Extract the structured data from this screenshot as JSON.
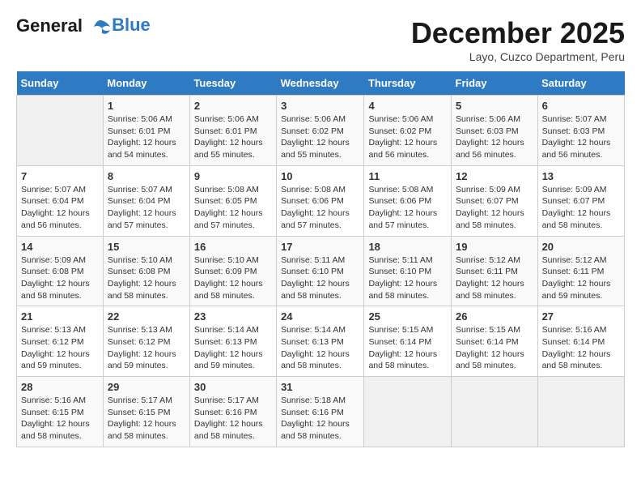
{
  "logo": {
    "line1": "General",
    "line2": "Blue"
  },
  "title": "December 2025",
  "location": "Layo, Cuzco Department, Peru",
  "days_of_week": [
    "Sunday",
    "Monday",
    "Tuesday",
    "Wednesday",
    "Thursday",
    "Friday",
    "Saturday"
  ],
  "weeks": [
    [
      {
        "num": "",
        "sunrise": "",
        "sunset": "",
        "daylight": ""
      },
      {
        "num": "1",
        "sunrise": "Sunrise: 5:06 AM",
        "sunset": "Sunset: 6:01 PM",
        "daylight": "Daylight: 12 hours and 54 minutes."
      },
      {
        "num": "2",
        "sunrise": "Sunrise: 5:06 AM",
        "sunset": "Sunset: 6:01 PM",
        "daylight": "Daylight: 12 hours and 55 minutes."
      },
      {
        "num": "3",
        "sunrise": "Sunrise: 5:06 AM",
        "sunset": "Sunset: 6:02 PM",
        "daylight": "Daylight: 12 hours and 55 minutes."
      },
      {
        "num": "4",
        "sunrise": "Sunrise: 5:06 AM",
        "sunset": "Sunset: 6:02 PM",
        "daylight": "Daylight: 12 hours and 56 minutes."
      },
      {
        "num": "5",
        "sunrise": "Sunrise: 5:06 AM",
        "sunset": "Sunset: 6:03 PM",
        "daylight": "Daylight: 12 hours and 56 minutes."
      },
      {
        "num": "6",
        "sunrise": "Sunrise: 5:07 AM",
        "sunset": "Sunset: 6:03 PM",
        "daylight": "Daylight: 12 hours and 56 minutes."
      }
    ],
    [
      {
        "num": "7",
        "sunrise": "Sunrise: 5:07 AM",
        "sunset": "Sunset: 6:04 PM",
        "daylight": "Daylight: 12 hours and 56 minutes."
      },
      {
        "num": "8",
        "sunrise": "Sunrise: 5:07 AM",
        "sunset": "Sunset: 6:04 PM",
        "daylight": "Daylight: 12 hours and 57 minutes."
      },
      {
        "num": "9",
        "sunrise": "Sunrise: 5:08 AM",
        "sunset": "Sunset: 6:05 PM",
        "daylight": "Daylight: 12 hours and 57 minutes."
      },
      {
        "num": "10",
        "sunrise": "Sunrise: 5:08 AM",
        "sunset": "Sunset: 6:06 PM",
        "daylight": "Daylight: 12 hours and 57 minutes."
      },
      {
        "num": "11",
        "sunrise": "Sunrise: 5:08 AM",
        "sunset": "Sunset: 6:06 PM",
        "daylight": "Daylight: 12 hours and 57 minutes."
      },
      {
        "num": "12",
        "sunrise": "Sunrise: 5:09 AM",
        "sunset": "Sunset: 6:07 PM",
        "daylight": "Daylight: 12 hours and 58 minutes."
      },
      {
        "num": "13",
        "sunrise": "Sunrise: 5:09 AM",
        "sunset": "Sunset: 6:07 PM",
        "daylight": "Daylight: 12 hours and 58 minutes."
      }
    ],
    [
      {
        "num": "14",
        "sunrise": "Sunrise: 5:09 AM",
        "sunset": "Sunset: 6:08 PM",
        "daylight": "Daylight: 12 hours and 58 minutes."
      },
      {
        "num": "15",
        "sunrise": "Sunrise: 5:10 AM",
        "sunset": "Sunset: 6:08 PM",
        "daylight": "Daylight: 12 hours and 58 minutes."
      },
      {
        "num": "16",
        "sunrise": "Sunrise: 5:10 AM",
        "sunset": "Sunset: 6:09 PM",
        "daylight": "Daylight: 12 hours and 58 minutes."
      },
      {
        "num": "17",
        "sunrise": "Sunrise: 5:11 AM",
        "sunset": "Sunset: 6:10 PM",
        "daylight": "Daylight: 12 hours and 58 minutes."
      },
      {
        "num": "18",
        "sunrise": "Sunrise: 5:11 AM",
        "sunset": "Sunset: 6:10 PM",
        "daylight": "Daylight: 12 hours and 58 minutes."
      },
      {
        "num": "19",
        "sunrise": "Sunrise: 5:12 AM",
        "sunset": "Sunset: 6:11 PM",
        "daylight": "Daylight: 12 hours and 58 minutes."
      },
      {
        "num": "20",
        "sunrise": "Sunrise: 5:12 AM",
        "sunset": "Sunset: 6:11 PM",
        "daylight": "Daylight: 12 hours and 59 minutes."
      }
    ],
    [
      {
        "num": "21",
        "sunrise": "Sunrise: 5:13 AM",
        "sunset": "Sunset: 6:12 PM",
        "daylight": "Daylight: 12 hours and 59 minutes."
      },
      {
        "num": "22",
        "sunrise": "Sunrise: 5:13 AM",
        "sunset": "Sunset: 6:12 PM",
        "daylight": "Daylight: 12 hours and 59 minutes."
      },
      {
        "num": "23",
        "sunrise": "Sunrise: 5:14 AM",
        "sunset": "Sunset: 6:13 PM",
        "daylight": "Daylight: 12 hours and 59 minutes."
      },
      {
        "num": "24",
        "sunrise": "Sunrise: 5:14 AM",
        "sunset": "Sunset: 6:13 PM",
        "daylight": "Daylight: 12 hours and 58 minutes."
      },
      {
        "num": "25",
        "sunrise": "Sunrise: 5:15 AM",
        "sunset": "Sunset: 6:14 PM",
        "daylight": "Daylight: 12 hours and 58 minutes."
      },
      {
        "num": "26",
        "sunrise": "Sunrise: 5:15 AM",
        "sunset": "Sunset: 6:14 PM",
        "daylight": "Daylight: 12 hours and 58 minutes."
      },
      {
        "num": "27",
        "sunrise": "Sunrise: 5:16 AM",
        "sunset": "Sunset: 6:14 PM",
        "daylight": "Daylight: 12 hours and 58 minutes."
      }
    ],
    [
      {
        "num": "28",
        "sunrise": "Sunrise: 5:16 AM",
        "sunset": "Sunset: 6:15 PM",
        "daylight": "Daylight: 12 hours and 58 minutes."
      },
      {
        "num": "29",
        "sunrise": "Sunrise: 5:17 AM",
        "sunset": "Sunset: 6:15 PM",
        "daylight": "Daylight: 12 hours and 58 minutes."
      },
      {
        "num": "30",
        "sunrise": "Sunrise: 5:17 AM",
        "sunset": "Sunset: 6:16 PM",
        "daylight": "Daylight: 12 hours and 58 minutes."
      },
      {
        "num": "31",
        "sunrise": "Sunrise: 5:18 AM",
        "sunset": "Sunset: 6:16 PM",
        "daylight": "Daylight: 12 hours and 58 minutes."
      },
      {
        "num": "",
        "sunrise": "",
        "sunset": "",
        "daylight": ""
      },
      {
        "num": "",
        "sunrise": "",
        "sunset": "",
        "daylight": ""
      },
      {
        "num": "",
        "sunrise": "",
        "sunset": "",
        "daylight": ""
      }
    ]
  ]
}
